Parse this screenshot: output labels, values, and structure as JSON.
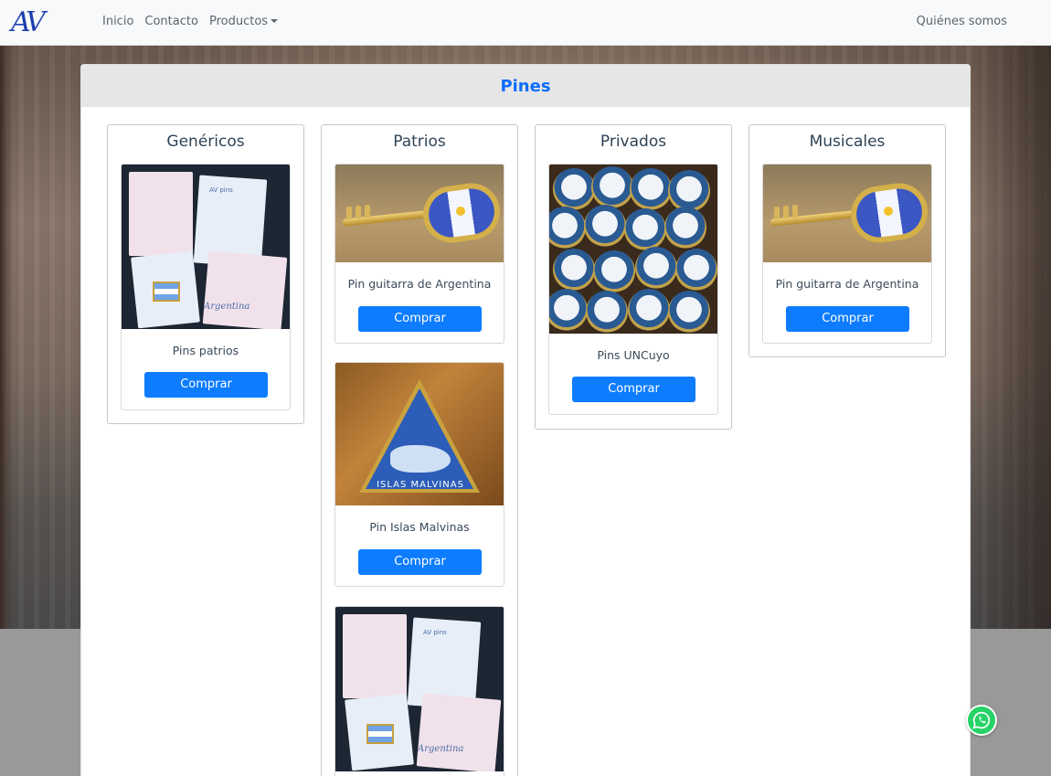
{
  "navbar": {
    "brand": "AV",
    "links": [
      "Inicio",
      "Contacto",
      "Productos"
    ],
    "right_link": "Quiénes somos"
  },
  "main": {
    "title": "Pines",
    "columns": [
      {
        "title": "Genéricos",
        "items": [
          {
            "name": "Pins patrios",
            "button": "Comprar",
            "image": "cards-image"
          }
        ]
      },
      {
        "title": "Patrios",
        "items": [
          {
            "name": "Pin guitarra de Argentina",
            "button": "Comprar",
            "image": "guitar-image"
          },
          {
            "name": "Pin Islas Malvinas",
            "button": "Comprar",
            "image": "malvinas-image"
          },
          {
            "name": "",
            "button": "",
            "image": "cards-image"
          }
        ]
      },
      {
        "title": "Privados",
        "items": [
          {
            "name": "Pins UNCuyo",
            "button": "Comprar",
            "image": "uncuyo-image"
          }
        ]
      },
      {
        "title": "Musicales",
        "items": [
          {
            "name": "Pin guitarra de Argentina",
            "button": "Comprar",
            "image": "guitar-image"
          }
        ]
      }
    ]
  },
  "image_texts": {
    "malvinas_pin_text": "ISLAS MALVINAS",
    "cards_card_text": "AV pins",
    "cards_script": "Argentina"
  },
  "colors": {
    "accent": "#0d7cff",
    "title": "#0d6efd",
    "whatsapp": "#25d366"
  },
  "icons": {
    "whatsapp": "whatsapp-icon",
    "productos_caret": "caret-down-icon"
  }
}
